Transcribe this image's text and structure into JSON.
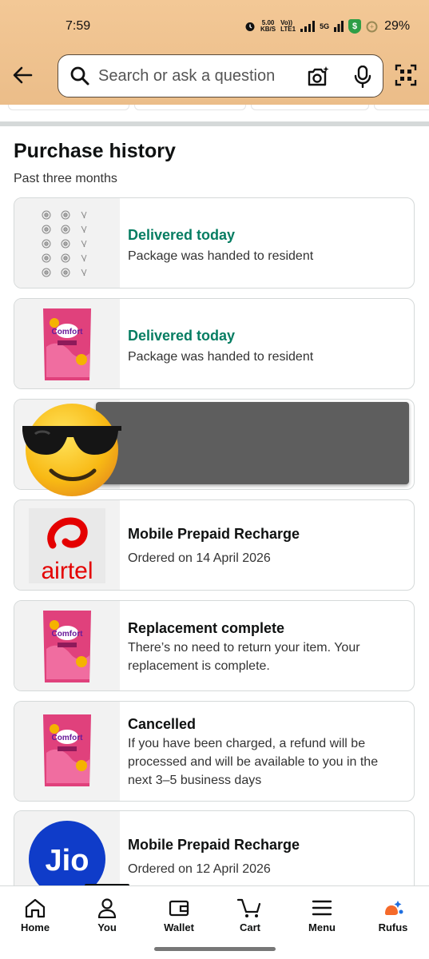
{
  "status_bar": {
    "time": "7:59",
    "net_speed_value": "5.00",
    "net_speed_unit": "KB/S",
    "volte_top": "Vo))",
    "volte_bottom": "LTE1",
    "network": "5G",
    "battery": "29%"
  },
  "search": {
    "placeholder": "Search or ask a question"
  },
  "colors": {
    "header_bg": "#ebbd89",
    "delivered_green": "#067d62",
    "airtel_red": "#e40000",
    "jio_blue": "#0f3cc9",
    "comfort_pink": "#e0417c"
  },
  "section": {
    "title": "Purchase history",
    "subtitle": "Past three months"
  },
  "orders": [
    {
      "image": "cable-clips-icon",
      "status": "Delivered today",
      "detail": "Package was handed to resident"
    },
    {
      "image": "comfort-fabric-conditioner-pack",
      "status": "Delivered today",
      "detail": "Package was handed to resident"
    },
    {
      "image": "redacted",
      "status": "",
      "detail": ""
    },
    {
      "image": "airtel-logo",
      "status": "Mobile Prepaid Recharge",
      "detail": "Ordered on 14 April 2026"
    },
    {
      "image": "comfort-fabric-conditioner-pack",
      "status": "Replacement complete",
      "detail": "There’s no need to return your item. Your replacement is complete."
    },
    {
      "image": "comfort-fabric-conditioner-pack",
      "status": "Cancelled",
      "detail": "If you have been charged, a refund will be processed and will be available to you in the next 3–5 business days"
    },
    {
      "image": "jio-logo",
      "status": "Mobile Prepaid Recharge",
      "detail": "Ordered on 12 April 2026"
    }
  ],
  "logos": {
    "airtel": "airtel",
    "jio": "Jio",
    "comfort": "Comfort"
  },
  "bottom_nav": [
    {
      "label": "Home",
      "icon": "home-icon"
    },
    {
      "label": "You",
      "icon": "person-icon"
    },
    {
      "label": "Wallet",
      "icon": "wallet-icon"
    },
    {
      "label": "Cart",
      "icon": "cart-icon"
    },
    {
      "label": "Menu",
      "icon": "menu-icon"
    },
    {
      "label": "Rufus",
      "icon": "rufus-icon"
    }
  ]
}
